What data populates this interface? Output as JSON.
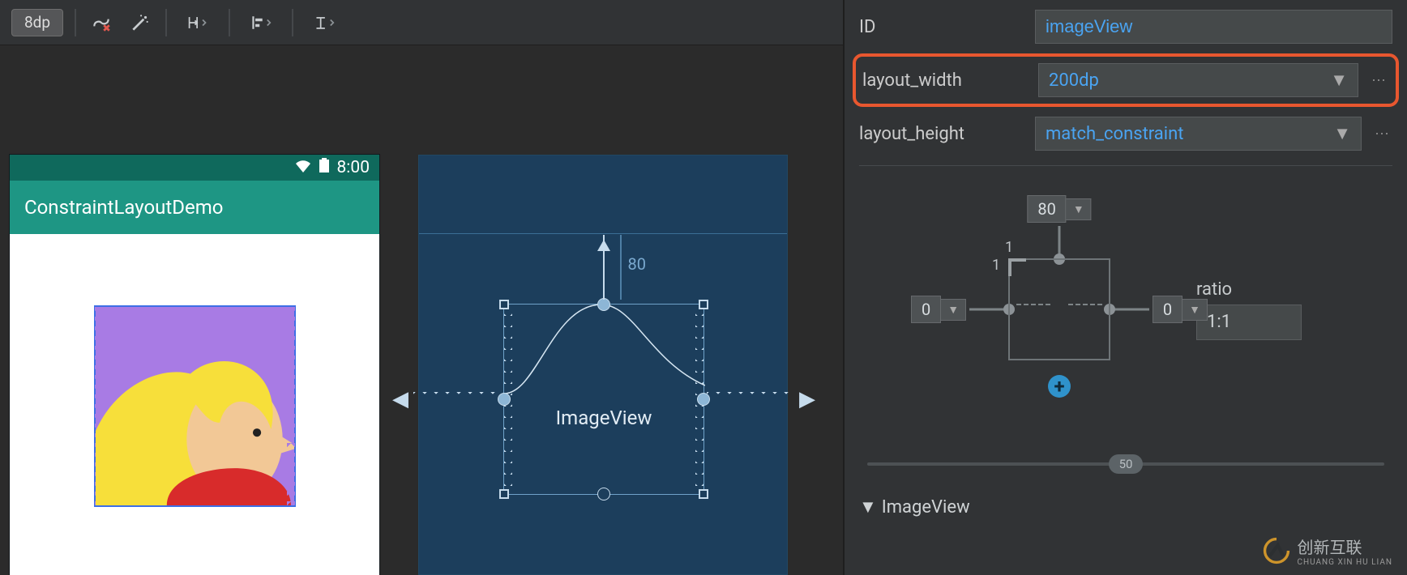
{
  "toolbar": {
    "default_margin": "8dp"
  },
  "preview": {
    "status_time": "8:00",
    "app_title": "ConstraintLayoutDemo"
  },
  "blueprint": {
    "view_label": "ImageView",
    "top_margin": "80"
  },
  "attributes": {
    "id_label": "ID",
    "id_value": "imageView",
    "width_label": "layout_width",
    "width_value": "200dp",
    "height_label": "layout_height",
    "height_value": "match_constraint"
  },
  "constraint_widget": {
    "top": "80",
    "left": "0",
    "right": "0",
    "corner_a": "1",
    "corner_b": "1"
  },
  "ratio": {
    "label": "ratio",
    "value": "1:1"
  },
  "slider": {
    "value": "50"
  },
  "section": {
    "title": "ImageView"
  },
  "watermark": {
    "brand": "创新互联",
    "sub": "CHUANG XIN HU LIAN"
  }
}
